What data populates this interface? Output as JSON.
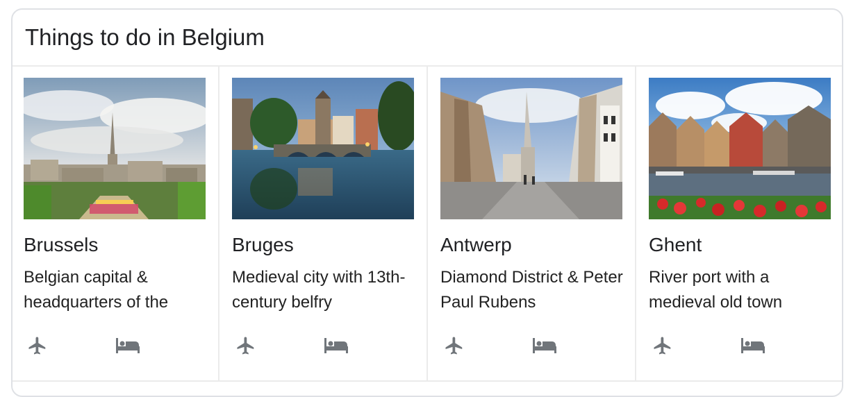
{
  "panel": {
    "title": "Things to do in Belgium"
  },
  "cards": [
    {
      "name": "Brussels",
      "description": "Belgian capital & headquarters of the",
      "icons": [
        "flight-icon",
        "hotel-icon"
      ]
    },
    {
      "name": "Bruges",
      "description": "Medieval city with 13th-century belfry",
      "icons": [
        "flight-icon",
        "hotel-icon"
      ]
    },
    {
      "name": "Antwerp",
      "description": "Diamond District & Peter Paul Rubens",
      "icons": [
        "flight-icon",
        "hotel-icon"
      ]
    },
    {
      "name": "Ghent",
      "description": "River port with a medieval old town",
      "icons": [
        "flight-icon",
        "hotel-icon"
      ]
    }
  ],
  "colors": {
    "text": "#202124",
    "icon": "#70757a",
    "border": "#dfe1e5",
    "divider": "#ebebeb"
  }
}
